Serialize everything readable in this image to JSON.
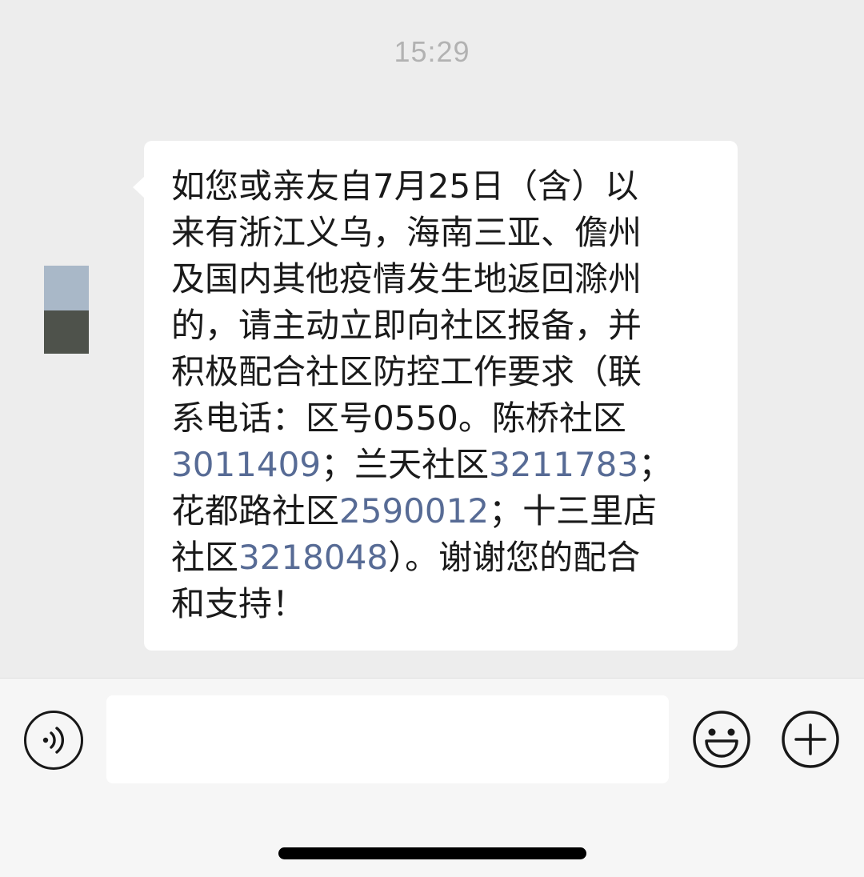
{
  "timestamp": "15:29",
  "avatar": {
    "colors": [
      "#a9b8c8",
      "#4e524b"
    ]
  },
  "message": {
    "line1": "如您或亲友自7月25日（含）以",
    "line2": "来有浙江义乌，海南三亚、儋州",
    "line3": "及国内其他疫情发生地返回滁州",
    "line4": "的，请主动立即向社区报备，并",
    "line5": "积极配合社区防控工作要求（联",
    "line6": "系电话：区号0550。陈桥社区",
    "line7_phone1": "3011409",
    "line7_text": "；兰天社区",
    "line7_phone2": "3211783",
    "line7_end": "；",
    "line8_text": "花都路社区",
    "line8_phone": "2590012",
    "line8_end": "；十三里店",
    "line9_text": "社区",
    "line9_phone": "3218048",
    "line9_end": "）。谢谢您的配合",
    "line10": "和支持！"
  },
  "input_bar": {
    "voice_icon": "voice-icon",
    "emoji_icon": "emoji-icon",
    "plus_icon": "plus-icon",
    "input_value": ""
  },
  "colors": {
    "background": "#ededed",
    "bubble": "#ffffff",
    "link": "#576b95",
    "timestamp": "#b2b2b2"
  }
}
